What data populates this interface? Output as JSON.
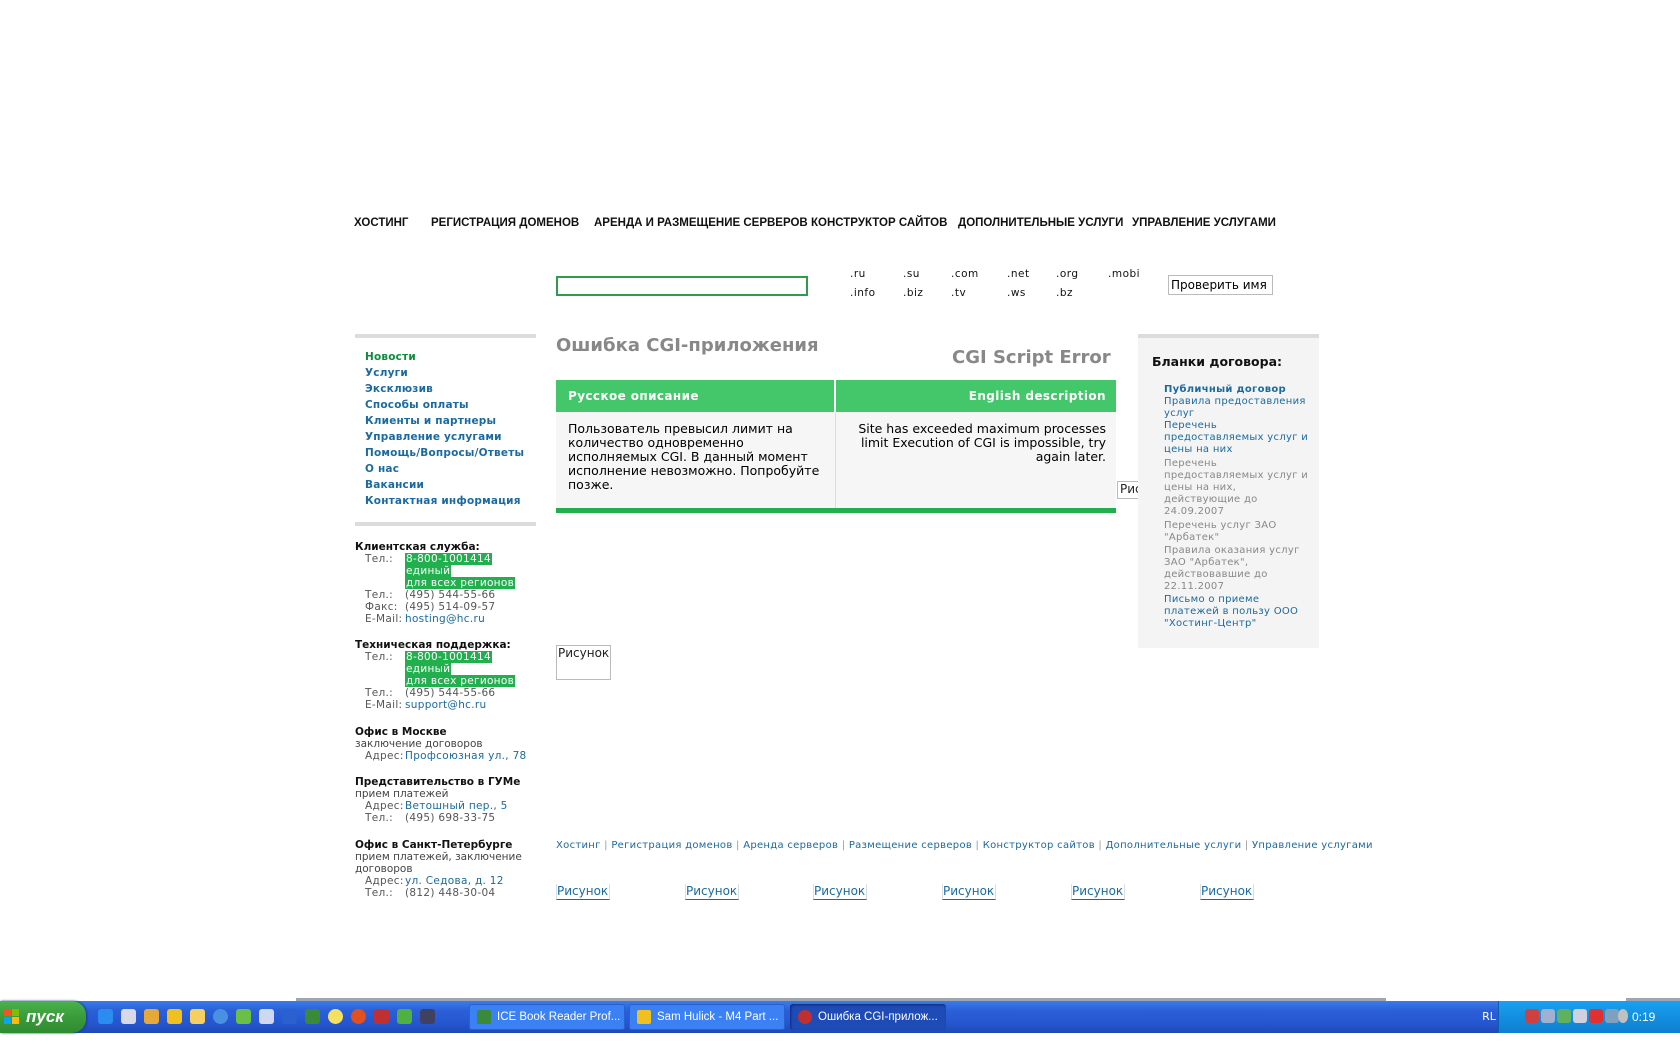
{
  "top_nav": [
    "ХОСТИНГ",
    "РЕГИСТРАЦИЯ ДОМЕНОВ",
    "АРЕНДА И РАЗМЕЩЕНИЕ СЕРВЕРОВ",
    "КОНСТРУКТОР САЙТОВ",
    "ДОПОЛНИТЕЛЬНЫЕ УСЛУГИ",
    "УПРАВЛЕНИЕ УСЛУГАМИ"
  ],
  "domain_search": {
    "value": "",
    "tlds_row1": [
      ".ru",
      ".su",
      ".com",
      ".net",
      ".org",
      ".mobi"
    ],
    "tlds_row2": [
      ".info",
      ".biz",
      ".tv",
      ".ws",
      ".bz"
    ],
    "button": "Проверить имя"
  },
  "left_nav": [
    "Новости",
    "Услуги",
    "Эксклюзив",
    "Способы оплаты",
    "Клиенты и партнеры",
    "Управление услугами",
    "Помощь/Вопросы/Ответы",
    "О нас",
    "Вакансии",
    "Контактная информация"
  ],
  "contacts": {
    "client_service": {
      "title": "Клиентская служба:",
      "tel_label": "Тел.:",
      "hotline": [
        "8-800-1001414",
        "единый",
        "для всех регионов"
      ],
      "tel2_label": "Тел.:",
      "tel2": "(495) 544-55-66",
      "fax_label": "Факс:",
      "fax": "(495) 514-09-57",
      "email_label": "E-Mail:",
      "email": "hosting@hc.ru"
    },
    "tech_support": {
      "title": "Техническая поддержка:",
      "tel_label": "Тел.:",
      "hotline": [
        "8-800-1001414",
        "единый",
        "для всех регионов"
      ],
      "tel2_label": "Тел.:",
      "tel2": "(495) 544-55-66",
      "email_label": "E-Mail:",
      "email": "support@hc.ru"
    },
    "moscow": {
      "title": "Офис в Москве",
      "subtitle": "заключение договоров",
      "address_label": "Адрес:",
      "address": "Профсоюзная ул., 78"
    },
    "gum": {
      "title": "Представительство в ГУМе",
      "subtitle": "прием платежей",
      "address_label": "Адрес:",
      "address": "Ветошный пер., 5",
      "tel_label": "Тел.:",
      "tel": "(495) 698-33-75"
    },
    "spb": {
      "title": "Офис в Санкт-Петербурге",
      "subtitle": [
        "прием платежей, заключение",
        "договоров"
      ],
      "address_label": "Адрес:",
      "address": "ул. Седова, д. 12",
      "tel_label": "Тел.:",
      "tel": "(812) 448-30-04"
    }
  },
  "main": {
    "title_ru": "Ошибка CGI-приложения",
    "title_en": "CGI Script Error",
    "col_ru": "Русское описание",
    "col_en": "English description",
    "text_ru": "Пользователь превысил лимит на количество одновременно исполняемых CGI. В данный момент исполнение невозможно. Попробуйте позже.",
    "text_en": "Site has exceeded maximum processes limit Execution of CGI is impossible, try again later.",
    "image_alt": "Рисунок",
    "image_alt_clipped": "Рис"
  },
  "right_sidebar": {
    "title": "Бланки договора:",
    "docs": [
      {
        "text": "Публичный договор",
        "style": "link-bold"
      },
      {
        "text": "Правила предоставления услуг",
        "style": "link"
      },
      {
        "text": "Перечень предоставляемых услуг и цены на них",
        "style": "link"
      },
      {
        "text": "Перечень предоставляемых услуг и цены на них, действующие до 24.09.2007",
        "style": "gray"
      },
      {
        "text": "Перечень услуг ЗАО \"Арбатек\"",
        "style": "gray"
      },
      {
        "text": "Правила оказания услуг ЗАО \"Арбатек\", действовавшие до 22.11.2007",
        "style": "gray"
      },
      {
        "text": "Письмо о приеме платежей в пользу ООО \"Хостинг-Центр\"",
        "style": "link"
      }
    ]
  },
  "footer": {
    "links": [
      "Хостинг",
      "Регистрация доменов",
      "Аренда серверов",
      "Размещение серверов",
      "Конструктор сайтов",
      "Дополнительные услуги",
      "Управление услугами"
    ],
    "separator": "|",
    "images": [
      "Рисунок",
      "Рисунок",
      "Рисунок",
      "Рисунок",
      "Рисунок",
      "Рисунок"
    ]
  },
  "taskbar": {
    "start_label": "пуск",
    "tasks": [
      {
        "label": "ICE Book Reader Prof...",
        "active": false,
        "icon": "book-icon"
      },
      {
        "label": "Sam Hulick - M4 Part ...",
        "active": false,
        "icon": "music-icon"
      },
      {
        "label": "Ошибка CGI-прилож...",
        "active": true,
        "icon": "browser-icon"
      }
    ],
    "lang": "RL",
    "clock": "0:19"
  }
}
